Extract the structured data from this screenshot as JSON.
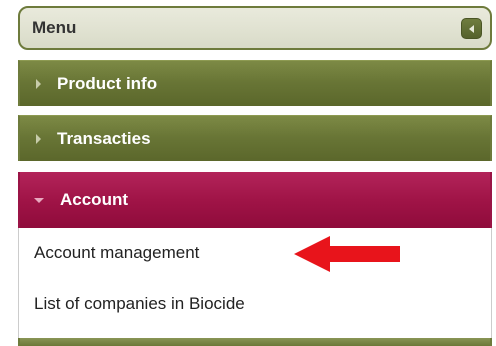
{
  "menu": {
    "title": "Menu",
    "collapse_icon": "collapse-left-icon"
  },
  "sections": [
    {
      "label": "Product info",
      "expanded": false,
      "color": "#697636"
    },
    {
      "label": "Transacties",
      "expanded": false,
      "color": "#697636"
    },
    {
      "label": "Account",
      "expanded": true,
      "color": "#a01447"
    }
  ],
  "account_items": [
    {
      "label": "Account management"
    },
    {
      "label": "List of companies in Biocide"
    }
  ],
  "annotation": {
    "arrow_color": "#e8141b",
    "icon": "red-pointer-arrow-icon"
  }
}
